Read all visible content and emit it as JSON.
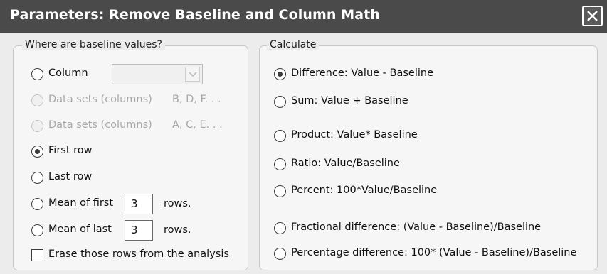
{
  "window": {
    "title": "Parameters: Remove Baseline and Column Math",
    "close_icon": "close-icon"
  },
  "baseline_group": {
    "legend": "Where are baseline values?",
    "options": [
      {
        "label": "Column",
        "selected": false,
        "disabled": false
      },
      {
        "label": "Data sets (columns)",
        "suffix": "B, D, F. . .",
        "selected": false,
        "disabled": true
      },
      {
        "label": "Data sets (columns)",
        "suffix": "A, C, E. . .",
        "selected": false,
        "disabled": true
      },
      {
        "label": "First row",
        "selected": true,
        "disabled": false
      },
      {
        "label": "Last row",
        "selected": false,
        "disabled": false
      },
      {
        "label": "Mean of first",
        "value": "3",
        "unit": "rows.",
        "selected": false,
        "disabled": false
      },
      {
        "label": "Mean of last",
        "value": "3",
        "unit": "rows.",
        "selected": false,
        "disabled": false
      }
    ],
    "column_select": {
      "value": "",
      "disabled": true,
      "arrow_icon": "chevron-down-icon"
    },
    "erase_checkbox": {
      "label": "Erase those rows from the analysis",
      "checked": false
    }
  },
  "calculate_group": {
    "legend": "Calculate",
    "options": [
      {
        "label": "Difference: Value - Baseline",
        "selected": true
      },
      {
        "label": "Sum: Value + Baseline",
        "selected": false
      },
      {
        "label": "Product: Value* Baseline",
        "selected": false
      },
      {
        "label": "Ratio: Value/Baseline",
        "selected": false
      },
      {
        "label": "Percent: 100*Value/Baseline",
        "selected": false
      },
      {
        "label": "Fractional difference:  (Value - Baseline)/Baseline",
        "selected": false
      },
      {
        "label": "Percentage difference: 100* (Value - Baseline)/Baseline",
        "selected": false
      }
    ]
  }
}
